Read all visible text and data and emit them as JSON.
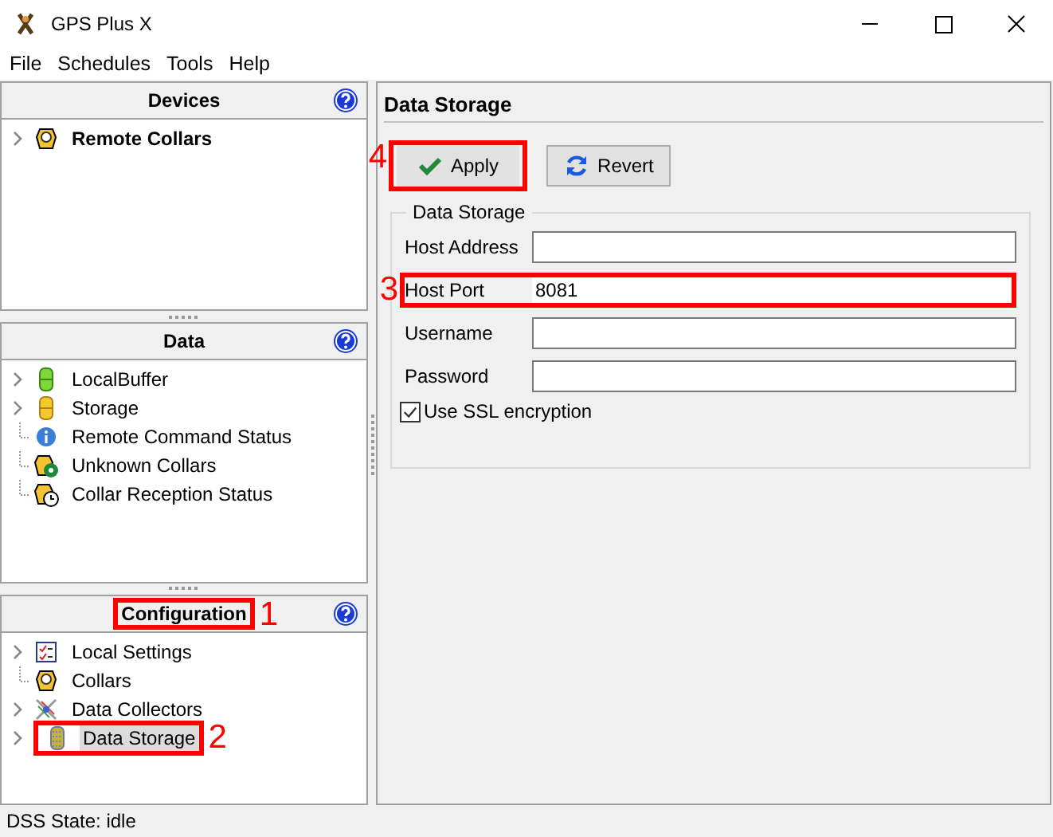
{
  "window": {
    "title": "GPS Plus X"
  },
  "menu": [
    "File",
    "Schedules",
    "Tools",
    "Help"
  ],
  "panels": [
    {
      "title": "Devices",
      "items": [
        {
          "label": "Remote Collars",
          "kind": "expandable",
          "bold": true,
          "selected": false
        }
      ]
    },
    {
      "title": "Data",
      "items": [
        {
          "label": "LocalBuffer",
          "kind": "expandable",
          "bold": false,
          "selected": false
        },
        {
          "label": "Storage",
          "kind": "expandable",
          "bold": false,
          "selected": false
        },
        {
          "label": "Remote Command Status",
          "kind": "leaf",
          "bold": false,
          "selected": false
        },
        {
          "label": "Unknown Collars",
          "kind": "leaf",
          "bold": false,
          "selected": false
        },
        {
          "label": "Collar Reception Status",
          "kind": "leaf",
          "bold": false,
          "selected": false
        }
      ]
    },
    {
      "title": "Configuration",
      "callout": "1",
      "items": [
        {
          "label": "Local Settings",
          "kind": "expandable",
          "bold": false,
          "selected": false
        },
        {
          "label": "Collars",
          "kind": "leaf",
          "bold": false,
          "selected": false
        },
        {
          "label": "Data Collectors",
          "kind": "expandable",
          "bold": false,
          "selected": false
        },
        {
          "label": "Data Storage",
          "kind": "expandable",
          "bold": false,
          "selected": true,
          "callout": "2"
        }
      ]
    }
  ],
  "detail": {
    "title": "Data Storage",
    "buttons": [
      {
        "label": "Apply",
        "kind": "apply",
        "callout": "4"
      },
      {
        "label": "Revert",
        "kind": "revert"
      }
    ],
    "group": {
      "title": "Data Storage",
      "fields": [
        {
          "label": "Host Address"
        },
        {
          "label": "Host Port",
          "value": "8081",
          "callout": "3"
        },
        {
          "label": "Username"
        },
        {
          "label": "Password"
        }
      ],
      "checkbox": {
        "label": "Use SSL encryption",
        "checked": true
      }
    }
  },
  "status_bar": "DSS State: idle"
}
